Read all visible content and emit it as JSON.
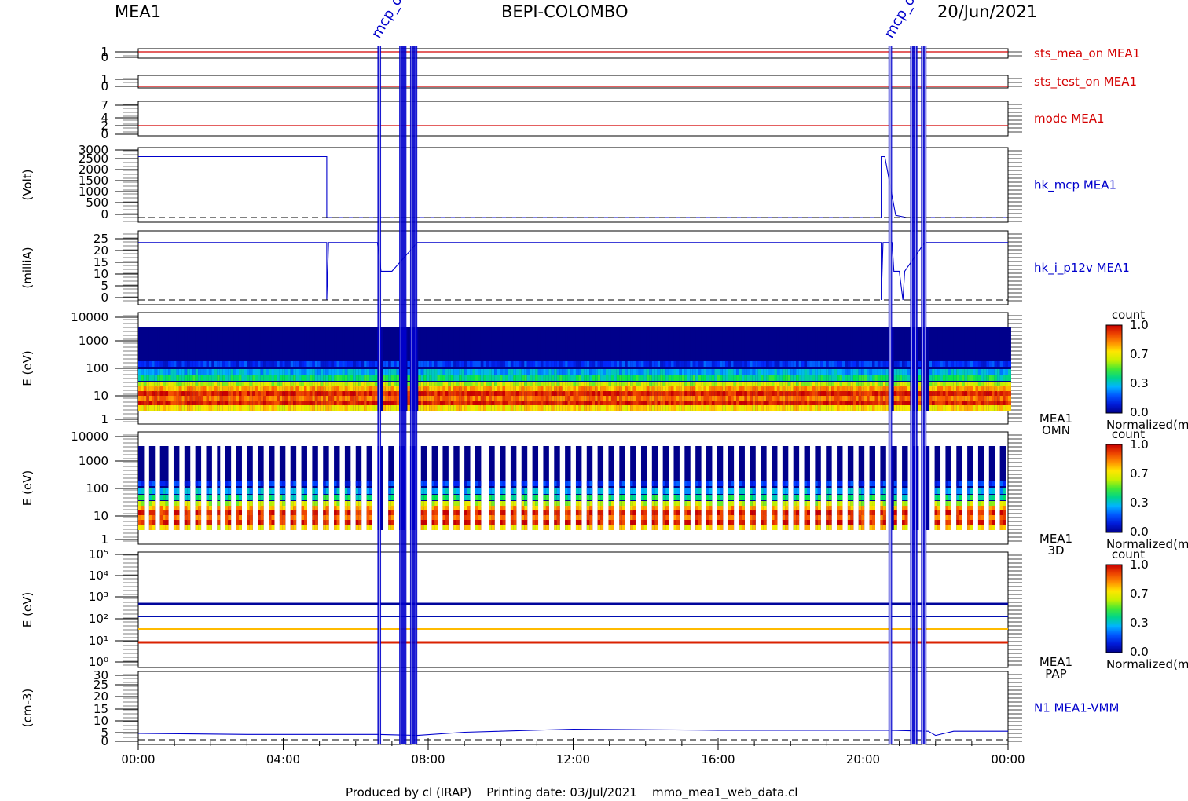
{
  "header": {
    "instrument": "MEA1",
    "mission": "BEPI-COLOMBO",
    "date": "20/Jun/2021"
  },
  "footer": {
    "produced": "Produced by cl (IRAP)",
    "printing": "Printing date: 03/Jul/2021",
    "script": "mmo_mea1_web_data.cl"
  },
  "colors": {
    "red": "#d40000",
    "blue": "#0000cc",
    "darkblue": "#00008b"
  },
  "chart_data": {
    "type": "multi-panel time series",
    "x_ticks": [
      "00:00",
      "04:00",
      "08:00",
      "12:00",
      "16:00",
      "20:00",
      "00:00"
    ],
    "x_range_hours": [
      0,
      24
    ],
    "event_labels": [
      {
        "text": "mcp_o",
        "hour": 6.65
      },
      {
        "text": "mcp_o",
        "hour": 20.8
      }
    ],
    "blue_bands_hours": [
      [
        6.6,
        6.7
      ],
      [
        7.2,
        7.4
      ],
      [
        7.5,
        7.7
      ],
      [
        20.7,
        20.8
      ],
      [
        21.3,
        21.5
      ],
      [
        21.6,
        21.75
      ]
    ],
    "panels": [
      {
        "id": "sts_mea_on",
        "label": "sts_mea_on MEA1",
        "label_color": "red",
        "yticks": [
          "1",
          "0"
        ],
        "ylabel": "",
        "value": 1
      },
      {
        "id": "sts_test_on",
        "label": "sts_test_on MEA1",
        "label_color": "red",
        "yticks": [
          "1",
          "0"
        ],
        "ylabel": "",
        "value": 0
      },
      {
        "id": "mode",
        "label": "mode MEA1",
        "label_color": "red",
        "yticks": [
          "7",
          "4",
          "2",
          "0"
        ],
        "ylabel": "",
        "value": 2
      },
      {
        "id": "hk_mcp",
        "label": "hk_mcp MEA1",
        "label_color": "blue",
        "yticks": [
          "3000",
          "2500",
          "2000",
          "1500",
          "1000",
          "500",
          "0"
        ],
        "ylabel": "(Volt)",
        "ylim": [
          0,
          3000
        ],
        "series": [
          [
            0,
            2800
          ],
          [
            5.2,
            2800
          ],
          [
            5.2,
            0
          ],
          [
            6.6,
            0
          ],
          [
            20.5,
            0
          ],
          [
            20.5,
            2800
          ],
          [
            20.6,
            2800
          ],
          [
            20.9,
            100
          ],
          [
            21.2,
            0
          ],
          [
            24,
            0
          ]
        ]
      },
      {
        "id": "hk_i_p12v",
        "label": "hk_i_p12v MEA1",
        "label_color": "blue",
        "yticks": [
          "25",
          "20",
          "15",
          "10",
          "5",
          "0"
        ],
        "ylabel": "(milliA)",
        "ylim": [
          0,
          28
        ],
        "series": [
          [
            0,
            25
          ],
          [
            5.2,
            25
          ],
          [
            5.2,
            0
          ],
          [
            5.25,
            25
          ],
          [
            6.6,
            25
          ],
          [
            6.7,
            12.5
          ],
          [
            7.0,
            12.5
          ],
          [
            7.7,
            25
          ],
          [
            20.5,
            25
          ],
          [
            20.5,
            0
          ],
          [
            20.55,
            25
          ],
          [
            20.8,
            25
          ],
          [
            20.85,
            12.5
          ],
          [
            21.0,
            12.5
          ],
          [
            21.1,
            0
          ],
          [
            21.15,
            12.5
          ],
          [
            21.7,
            25
          ],
          [
            24,
            25
          ]
        ]
      },
      {
        "id": "omn",
        "label": "MEA1",
        "label2": "OMN",
        "yticks": [
          "10000",
          "1000",
          "100",
          "10",
          "1"
        ],
        "ylabel": "E (eV)",
        "colorbar": {
          "title": "count",
          "ticks": [
            "1.0",
            "0.7",
            "0.3",
            "0.0"
          ],
          "caption": "Normalized(m"
        }
      },
      {
        "id": "d3",
        "label": "MEA1",
        "label2": "3D",
        "yticks": [
          "10000",
          "1000",
          "100",
          "10",
          "1"
        ],
        "ylabel": "E (eV)",
        "colorbar": {
          "title": "count",
          "ticks": [
            "1.0",
            "0.7",
            "0.3",
            "0.0"
          ],
          "caption": "Normalized(m"
        }
      },
      {
        "id": "pap",
        "label": "MEA1",
        "label2": "PAP",
        "yticks": [
          "10⁵",
          "10⁴",
          "10³",
          "10²",
          "10¹",
          "10⁰"
        ],
        "ylabel": "E (eV)",
        "colorbar": {
          "title": "count",
          "ticks": [
            "1.0",
            "0.7",
            "0.3",
            "0.0"
          ],
          "caption": "Normalized(m"
        }
      },
      {
        "id": "density",
        "label": "N1 MEA1-VMM",
        "label_color": "blue",
        "yticks": [
          "30",
          "25",
          "20",
          "15",
          "10",
          "5",
          "0"
        ],
        "ylabel": "(cm-3)",
        "ylim": [
          0,
          30
        ],
        "series": [
          [
            0,
            3
          ],
          [
            3,
            2.5
          ],
          [
            6.6,
            2.5
          ],
          [
            7.7,
            2
          ],
          [
            9,
            3.5
          ],
          [
            12,
            5
          ],
          [
            16,
            4.5
          ],
          [
            20.7,
            4.5
          ],
          [
            21.8,
            4
          ],
          [
            22,
            2
          ],
          [
            22.5,
            4
          ],
          [
            24,
            4
          ]
        ]
      }
    ]
  }
}
